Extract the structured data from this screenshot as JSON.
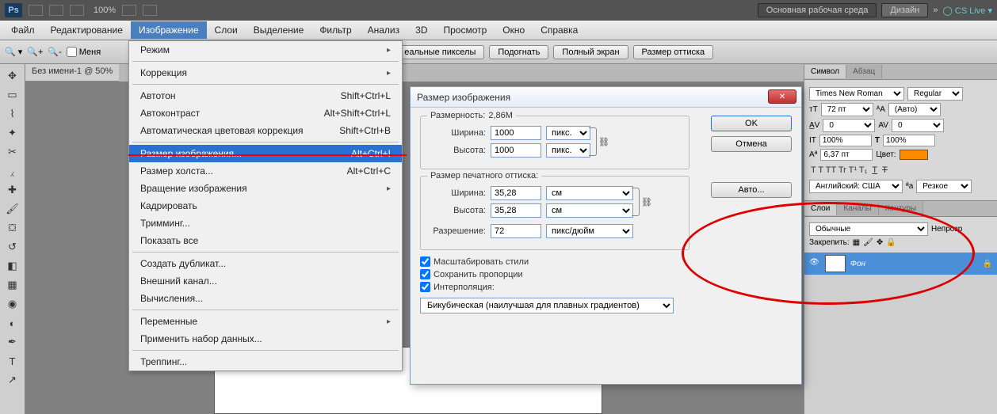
{
  "app": {
    "logo": "Ps",
    "zoom": "100%",
    "cslive": "CS Live"
  },
  "topbuttons": {
    "workspace": "Основная рабочая среда",
    "design": "Дизайн"
  },
  "menu": {
    "file": "Файл",
    "edit": "Редактирование",
    "image": "Изображение",
    "layer": "Слои",
    "select": "Выделение",
    "filter": "Фильтр",
    "analysis": "Анализ",
    "three_d": "3D",
    "view": "Просмотр",
    "window": "Окно",
    "help": "Справка"
  },
  "options": {
    "menya": "Меня",
    "real_pixels": "еальные пикселы",
    "fit": "Подогнать",
    "fullscreen": "Полный экран",
    "print_size": "Размер оттиска"
  },
  "doc_tab": "Без имени-1 @ 50%",
  "dropdown": {
    "mode": "Режим",
    "adjustments": "Коррекция",
    "autotone": "Автотон",
    "autotone_sc": "Shift+Ctrl+L",
    "autocontrast": "Автоконтраст",
    "autocontrast_sc": "Alt+Shift+Ctrl+L",
    "autocolor": "Автоматическая цветовая коррекция",
    "autocolor_sc": "Shift+Ctrl+B",
    "imagesize": "Размер изображения...",
    "imagesize_sc": "Alt+Ctrl+I",
    "canvassize": "Размер холста...",
    "canvassize_sc": "Alt+Ctrl+C",
    "rotation": "Вращение изображения",
    "crop": "Кадрировать",
    "trim": "Тримминг...",
    "reveal": "Показать все",
    "duplicate": "Создать дубликат...",
    "apply": "Внешний канал...",
    "calc": "Вычисления...",
    "variables": "Переменные",
    "applyds": "Применить набор данных...",
    "trap": "Треппинг..."
  },
  "dialog": {
    "title": "Размер изображения",
    "dimensions_lbl": "Размерность:",
    "dimensions_val": "2,86M",
    "width_lbl": "Ширина:",
    "height_lbl": "Высота:",
    "px_w": "1000",
    "px_h": "1000",
    "px_unit": "пикс.",
    "print_lbl": "Размер печатного оттиска:",
    "doc_w": "35,28",
    "doc_h": "35,28",
    "doc_unit": "см",
    "res_lbl": "Разрешение:",
    "res_val": "72",
    "res_unit": "пикс/дюйм",
    "scale_styles": "Масштабировать стили",
    "constrain": "Сохранить пропорции",
    "resample": "Интерполяция:",
    "method": "Бикубическая (наилучшая для плавных градиентов)",
    "ok": "OK",
    "cancel": "Отмена",
    "auto": "Авто..."
  },
  "char": {
    "tab_symbol": "Символ",
    "tab_paragraph": "Абзац",
    "font": "Times New Roman",
    "style": "Regular",
    "size": "72 пт",
    "leading": "(Авто)",
    "tracking": "0",
    "kerning": "0",
    "vscale": "100%",
    "hscale": "100%",
    "baseline": "6,37 пт",
    "color_lbl": "Цвет:",
    "lang": "Английский: США",
    "aa": "Резкое"
  },
  "layers": {
    "tab_layers": "Слои",
    "tab_channels": "Каналы",
    "tab_paths": "Контуры",
    "mode": "Обычные",
    "opacity_lbl": "Непрозр",
    "lock_lbl": "Закрепить:",
    "bg": "Фон"
  }
}
